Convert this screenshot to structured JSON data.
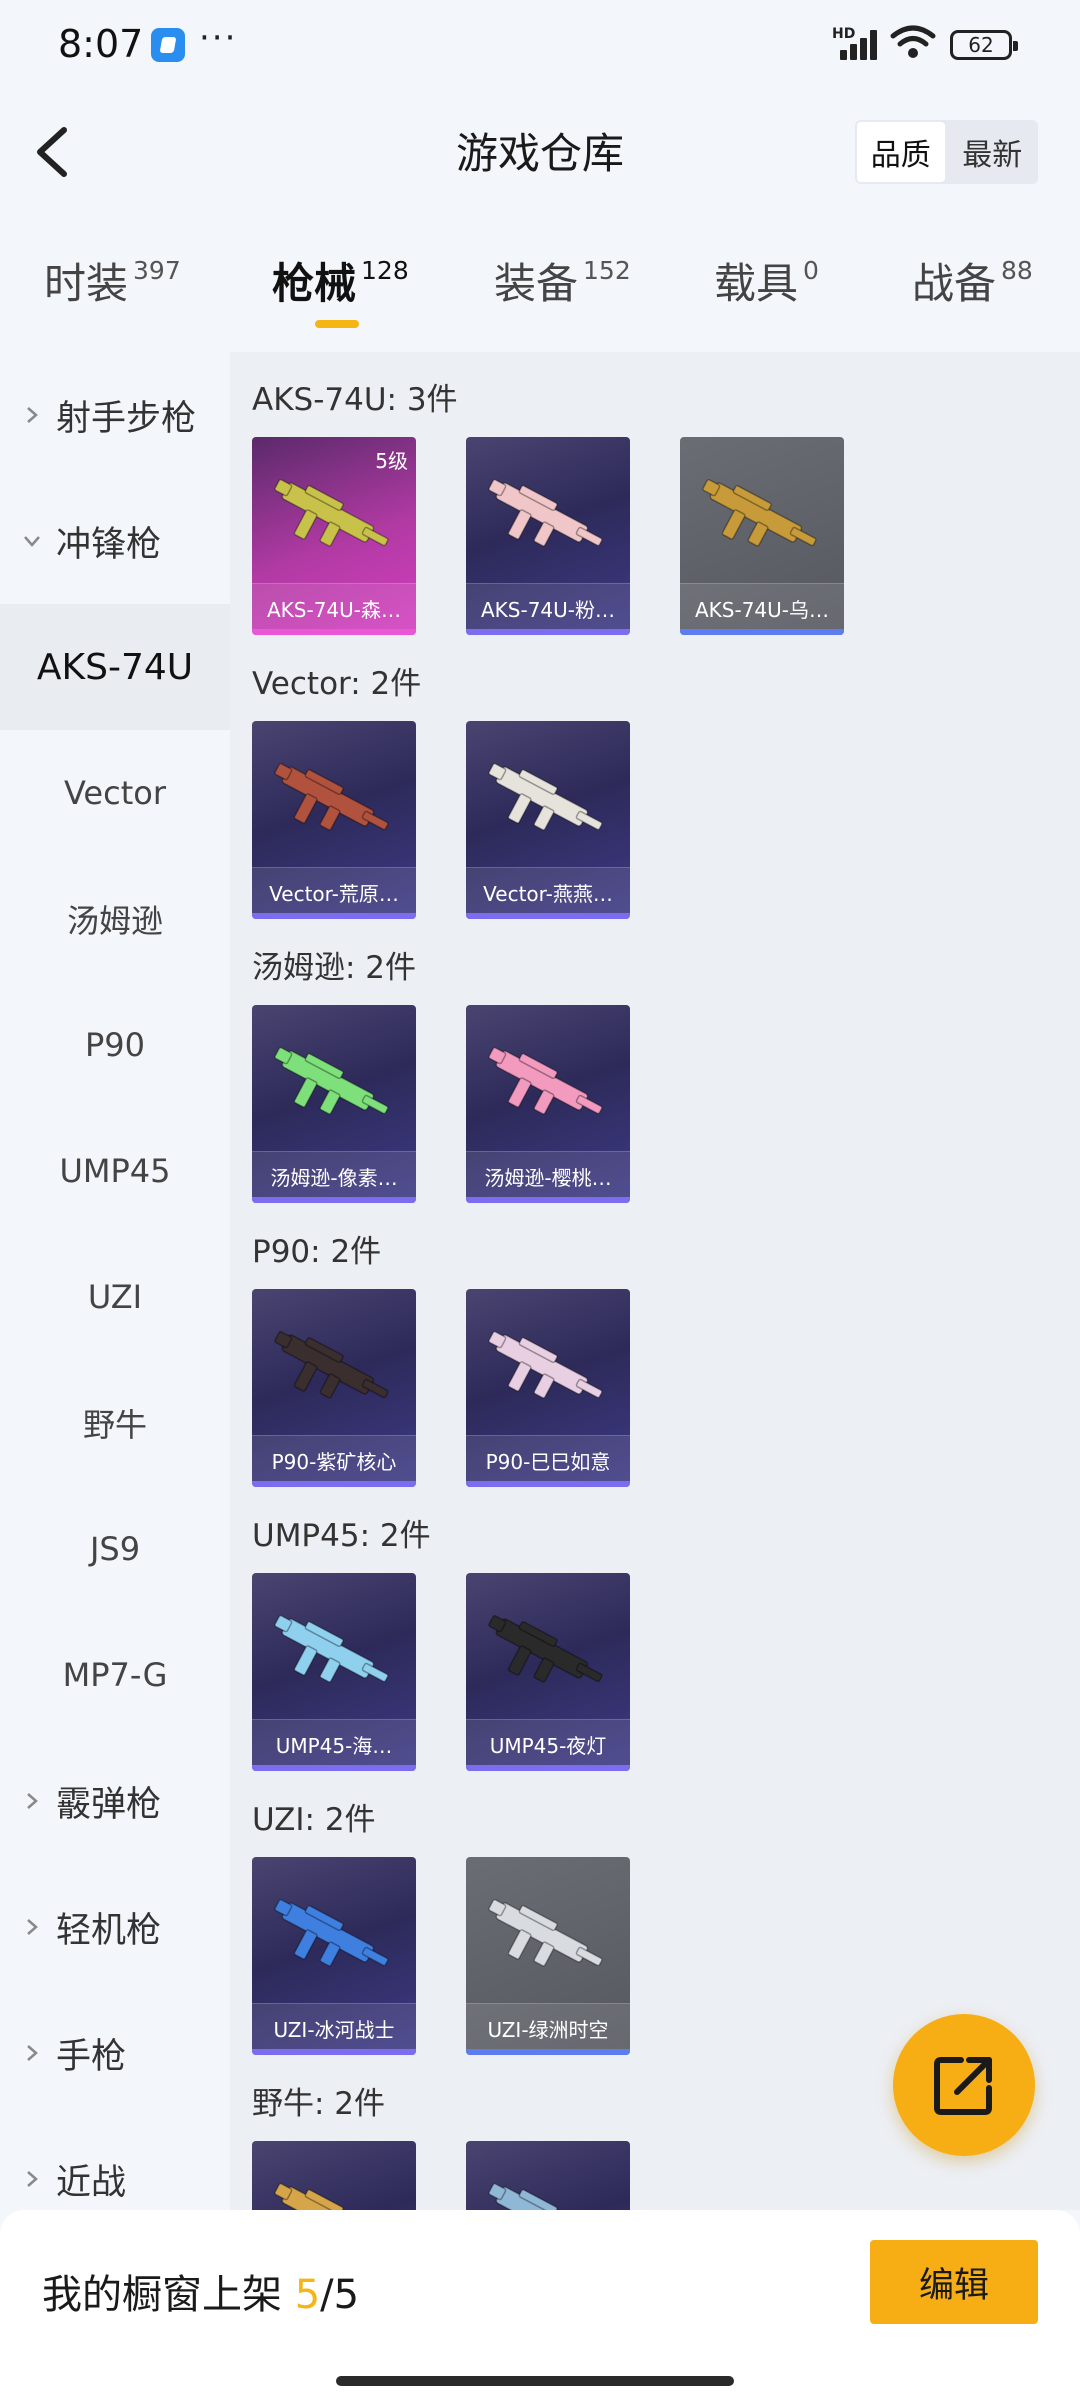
{
  "status": {
    "time": "8:07",
    "more": "···",
    "hd": "HD",
    "battery": "62"
  },
  "header": {
    "title": "游戏仓库",
    "sort_options": [
      "品质",
      "最新"
    ]
  },
  "category_tabs": [
    {
      "label": "时装",
      "count": "397"
    },
    {
      "label": "枪械",
      "count": "128"
    },
    {
      "label": "装备",
      "count": "152"
    },
    {
      "label": "载具",
      "count": "0"
    },
    {
      "label": "战备",
      "count": "88"
    }
  ],
  "sidebar": {
    "groups": {
      "marksman": "射手步枪",
      "smg": "冲锋枪",
      "shotgun": "霰弹枪",
      "lmg": "轻机枪",
      "pistol": "手枪",
      "melee": "近战"
    },
    "smg_items": [
      "AKS-74U",
      "Vector",
      "汤姆逊",
      "P90",
      "UMP45",
      "UZI",
      "野牛",
      "JS9",
      "MP7-G"
    ]
  },
  "sections": [
    {
      "title": "AKS-74U: 3件",
      "items": [
        {
          "name": "AKS-74U-森…",
          "level": "5级",
          "rarity": "pink",
          "gun_color": "#c9c24a"
        },
        {
          "name": "AKS-74U-粉…",
          "rarity": "purple",
          "gun_color": "#f0c6c8"
        },
        {
          "name": "AKS-74U-乌…",
          "rarity": "gray",
          "gun_color": "#c79a3a"
        }
      ]
    },
    {
      "title": "Vector: 2件",
      "items": [
        {
          "name": "Vector-荒原…",
          "rarity": "purple",
          "gun_color": "#b0523e"
        },
        {
          "name": "Vector-燕燕…",
          "rarity": "purple",
          "gun_color": "#e6e2dc"
        }
      ]
    },
    {
      "title": "汤姆逊: 2件",
      "items": [
        {
          "name": "汤姆逊-像素…",
          "rarity": "purple",
          "gun_color": "#7ee07a"
        },
        {
          "name": "汤姆逊-樱桃…",
          "rarity": "purple",
          "gun_color": "#f29bbf"
        }
      ]
    },
    {
      "title": "P90: 2件",
      "items": [
        {
          "name": "P90-紫矿核心",
          "rarity": "purple",
          "gun_color": "#3a2e2e"
        },
        {
          "name": "P90-巳巳如意",
          "rarity": "purple",
          "gun_color": "#e8cfe2"
        }
      ]
    },
    {
      "title": "UMP45: 2件",
      "items": [
        {
          "name": "UMP45-海…",
          "rarity": "purple",
          "gun_color": "#8fd0ef"
        },
        {
          "name": "UMP45-夜灯",
          "rarity": "purple",
          "gun_color": "#2a2a2a"
        }
      ]
    },
    {
      "title": "UZI: 2件",
      "items": [
        {
          "name": "UZI-冰河战士",
          "rarity": "purple",
          "gun_color": "#3f7fe0"
        },
        {
          "name": "UZI-绿洲时空",
          "rarity": "gray",
          "gun_color": "#d8dbe0"
        }
      ]
    },
    {
      "title": "野牛: 2件",
      "items": [
        {
          "name": "",
          "rarity": "purple",
          "gun_color": "#d6a54a"
        },
        {
          "name": "",
          "rarity": "purple",
          "gun_color": "#8fb7d6"
        }
      ]
    }
  ],
  "bottom": {
    "prefix": "我的橱窗上架 ",
    "current": "5",
    "total": "/5",
    "edit_label": "编辑"
  },
  "colors": {
    "accent": "#f5b514",
    "card_purple": "#3e3a86",
    "card_pink": "#d43fc0",
    "card_gray": "#55585f"
  }
}
